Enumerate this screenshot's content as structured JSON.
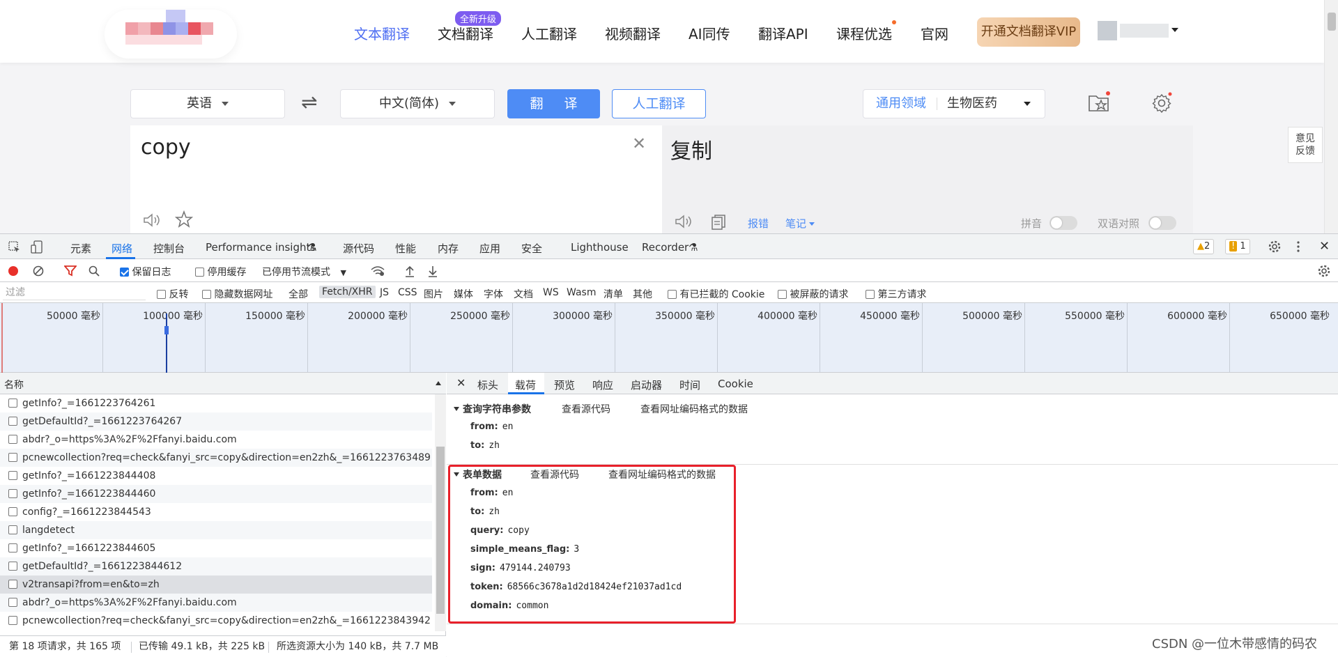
{
  "nav": {
    "items": [
      "文本翻译",
      "文档翻译",
      "人工翻译",
      "视频翻译",
      "AI同传",
      "翻译API",
      "课程优选",
      "官网"
    ],
    "badge": "全新升级",
    "vip_button": "开通文档翻译VIP",
    "accent_color": "#4e6ef2"
  },
  "translator": {
    "source_lang": "英语",
    "target_lang": "中文(简体)",
    "swap_icon": "⇌",
    "translate_button": "翻 译",
    "human_button": "人工翻译",
    "domain_general": "通用领域",
    "domain_selected": "生物医药",
    "source_text": "copy",
    "target_text": "复制",
    "report_link": "报错",
    "notes_link": "笔记",
    "pinyin_label": "拼音",
    "bilingual_label": "双语对照",
    "feedback": [
      "意见",
      "反馈"
    ]
  },
  "devtools": {
    "tabs": [
      "元素",
      "网络",
      "控制台",
      "Performance insights",
      "源代码",
      "性能",
      "内存",
      "应用",
      "安全",
      "Lighthouse",
      "Recorder"
    ],
    "warnings_count": "2",
    "issues_count": "1",
    "toolbar": {
      "preserve_log": "保留日志",
      "disable_cache": "停用缓存",
      "throttling": "已停用节流模式"
    },
    "filter": {
      "placeholder": "过滤",
      "invert": "反转",
      "hide_data_urls": "隐藏数据网址",
      "types": [
        "全部",
        "Fetch/XHR",
        "JS",
        "CSS",
        "图片",
        "媒体",
        "字体",
        "文档",
        "WS",
        "Wasm",
        "清单",
        "其他"
      ],
      "blocked_cookies": "有已拦截的 Cookie",
      "blocked_requests": "被屏蔽的请求",
      "third_party": "第三方请求"
    },
    "timeline_ticks": [
      "50000 毫秒",
      "100000 毫秒",
      "150000 毫秒",
      "200000 毫秒",
      "250000 毫秒",
      "300000 毫秒",
      "350000 毫秒",
      "400000 毫秒",
      "450000 毫秒",
      "500000 毫秒",
      "550000 毫秒",
      "600000 毫秒",
      "650000 毫秒"
    ],
    "requests_header": "名称",
    "requests": [
      "getInfo?_=1661223764261",
      "getDefaultId?_=1661223764267",
      "abdr?_o=https%3A%2F%2Ffanyi.baidu.com",
      "pcnewcollection?req=check&fanyi_src=copy&direction=en2zh&_=1661223763489",
      "getInfo?_=1661223844408",
      "getInfo?_=1661223844460",
      "config?_=1661223844543",
      "langdetect",
      "getInfo?_=1661223844605",
      "getDefaultId?_=1661223844612",
      "v2transapi?from=en&to=zh",
      "abdr?_o=https%3A%2F%2Ffanyi.baidu.com",
      "pcnewcollection?req=check&fanyi_src=copy&direction=en2zh&_=1661223843942"
    ],
    "status": {
      "requests": "第 18 项请求，共 165 项",
      "transferred": "已传输 49.1 kB，共 225 kB",
      "resources": "所选资源大小为 140 kB，共 7.7 MB"
    },
    "detail_tabs": [
      "标头",
      "载荷",
      "预览",
      "响应",
      "启动器",
      "时间",
      "Cookie"
    ],
    "query_section": {
      "title": "查询字符串参数",
      "view_source": "查看源代码",
      "view_encoded": "查看网址编码格式的数据",
      "params": [
        {
          "key": "from:",
          "value": "en"
        },
        {
          "key": "to:",
          "value": "zh"
        }
      ]
    },
    "form_section": {
      "title": "表单数据",
      "view_source": "查看源代码",
      "view_encoded": "查看网址编码格式的数据",
      "params": [
        {
          "key": "from:",
          "value": "en"
        },
        {
          "key": "to:",
          "value": "zh"
        },
        {
          "key": "query:",
          "value": "copy"
        },
        {
          "key": "simple_means_flag:",
          "value": "3"
        },
        {
          "key": "sign:",
          "value": "479144.240793"
        },
        {
          "key": "token:",
          "value": "68566c3678a1d2d18424ef21037ad1cd"
        },
        {
          "key": "domain:",
          "value": "common"
        }
      ]
    }
  },
  "watermark": "CSDN @一位木带感情的码农"
}
